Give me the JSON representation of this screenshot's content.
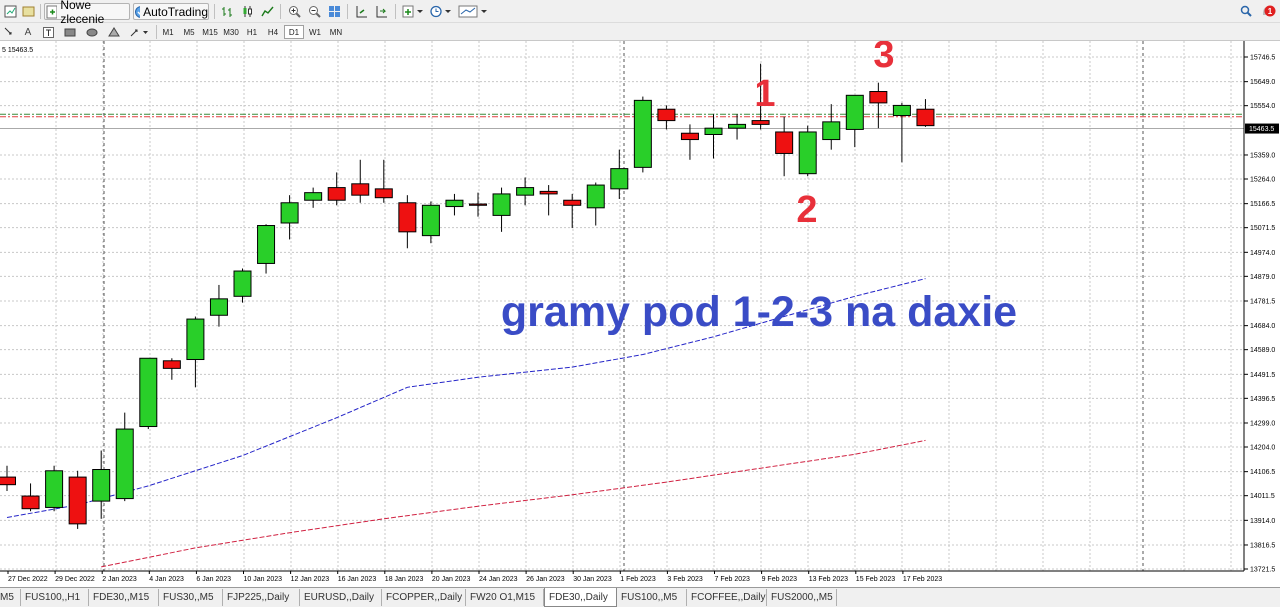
{
  "toolbar": {
    "new_order_label": "Nowe zlecenie",
    "autotrading_label": "AutoTrading",
    "notification_count": "1"
  },
  "timeframes": [
    "M1",
    "M5",
    "M15",
    "M30",
    "H1",
    "H4",
    "D1",
    "W1",
    "MN"
  ],
  "active_timeframe": "D1",
  "chart_header": "5 15463.5",
  "annotation": {
    "caption": "gramy pod 1-2-3 na daxie",
    "point1": "1",
    "point2": "2",
    "point3": "3",
    "caption_color": "#3a4cc6",
    "number_color": "#e8303a"
  },
  "tabs": [
    "M5",
    "FUS100,,H1",
    "FDE30,,M15",
    "FUS30,,M5",
    "FJP225,,Daily",
    "EURUSD,,Daily",
    "FCOPPER,,Daily",
    "FW20 O1,M15",
    "FDE30,,Daily",
    "FUS100,,M5",
    "FCOFFEE,,Daily",
    "FUS2000,,M5"
  ],
  "active_tab": "FDE30,,Daily",
  "chart_data": {
    "type": "candlestick",
    "y_ticks": [
      "15746.5",
      "15649.0",
      "15554.0",
      "15359.0",
      "15264.0",
      "15166.5",
      "15071.5",
      "14974.0",
      "14879.0",
      "14781.5",
      "14684.0",
      "14589.0",
      "14491.5",
      "14396.5",
      "14299.0",
      "14204.0",
      "14106.5",
      "14011.5",
      "13914.0",
      "13816.5",
      "13721.5"
    ],
    "current_price": "15463.5",
    "ylim": [
      13700,
      15800
    ],
    "x_labels": [
      "27 Dec 2022",
      "29 Dec 2022",
      "2 Jan 2023",
      "4 Jan 2023",
      "6 Jan 2023",
      "10 Jan 2023",
      "12 Jan 2023",
      "16 Jan 2023",
      "18 Jan 2023",
      "20 Jan 2023",
      "24 Jan 2023",
      "26 Jan 2023",
      "30 Jan 2023",
      "1 Feb 2023",
      "3 Feb 2023",
      "7 Feb 2023",
      "9 Feb 2023",
      "13 Feb 2023",
      "15 Feb 2023",
      "17 Feb 2023"
    ],
    "candles": [
      {
        "o": 14085,
        "h": 14130,
        "l": 14030,
        "c": 14055
      },
      {
        "o": 14010,
        "h": 14060,
        "l": 13950,
        "c": 13960
      },
      {
        "o": 13965,
        "h": 14130,
        "l": 13950,
        "c": 14110
      },
      {
        "o": 14085,
        "h": 14110,
        "l": 13880,
        "c": 13900
      },
      {
        "o": 13990,
        "h": 14190,
        "l": 13920,
        "c": 14115
      },
      {
        "o": 14000,
        "h": 14340,
        "l": 13990,
        "c": 14275
      },
      {
        "o": 14285,
        "h": 14555,
        "l": 14275,
        "c": 14555
      },
      {
        "o": 14545,
        "h": 14555,
        "l": 14470,
        "c": 14515
      },
      {
        "o": 14550,
        "h": 14720,
        "l": 14440,
        "c": 14710
      },
      {
        "o": 14725,
        "h": 14845,
        "l": 14680,
        "c": 14790
      },
      {
        "o": 14800,
        "h": 14910,
        "l": 14775,
        "c": 14900
      },
      {
        "o": 14930,
        "h": 15085,
        "l": 14890,
        "c": 15080
      },
      {
        "o": 15090,
        "h": 15200,
        "l": 15025,
        "c": 15170
      },
      {
        "o": 15180,
        "h": 15230,
        "l": 15150,
        "c": 15210
      },
      {
        "o": 15230,
        "h": 15290,
        "l": 15160,
        "c": 15180
      },
      {
        "o": 15245,
        "h": 15340,
        "l": 15170,
        "c": 15200
      },
      {
        "o": 15225,
        "h": 15340,
        "l": 15170,
        "c": 15190
      },
      {
        "o": 15170,
        "h": 15200,
        "l": 14990,
        "c": 15055
      },
      {
        "o": 15040,
        "h": 15175,
        "l": 15010,
        "c": 15160
      },
      {
        "o": 15155,
        "h": 15205,
        "l": 15120,
        "c": 15180
      },
      {
        "o": 15165,
        "h": 15210,
        "l": 15115,
        "c": 15160
      },
      {
        "o": 15120,
        "h": 15230,
        "l": 15055,
        "c": 15205
      },
      {
        "o": 15200,
        "h": 15270,
        "l": 15160,
        "c": 15230
      },
      {
        "o": 15215,
        "h": 15240,
        "l": 15120,
        "c": 15205
      },
      {
        "o": 15180,
        "h": 15205,
        "l": 15070,
        "c": 15160
      },
      {
        "o": 15150,
        "h": 15250,
        "l": 15080,
        "c": 15240
      },
      {
        "o": 15225,
        "h": 15380,
        "l": 15185,
        "c": 15305
      },
      {
        "o": 15310,
        "h": 15590,
        "l": 15290,
        "c": 15575
      },
      {
        "o": 15540,
        "h": 15555,
        "l": 15460,
        "c": 15495
      },
      {
        "o": 15445,
        "h": 15480,
        "l": 15340,
        "c": 15420
      },
      {
        "o": 15440,
        "h": 15520,
        "l": 15345,
        "c": 15465
      },
      {
        "o": 15465,
        "h": 15520,
        "l": 15420,
        "c": 15480
      },
      {
        "o": 15495,
        "h": 15720,
        "l": 15460,
        "c": 15480
      },
      {
        "o": 15450,
        "h": 15510,
        "l": 15275,
        "c": 15365
      },
      {
        "o": 15285,
        "h": 15475,
        "l": 15275,
        "c": 15450
      },
      {
        "o": 15420,
        "h": 15560,
        "l": 15380,
        "c": 15490
      },
      {
        "o": 15460,
        "h": 15595,
        "l": 15390,
        "c": 15595
      },
      {
        "o": 15610,
        "h": 15645,
        "l": 15465,
        "c": 15565
      },
      {
        "o": 15515,
        "h": 15565,
        "l": 15330,
        "c": 15555
      },
      {
        "o": 15540,
        "h": 15580,
        "l": 15470,
        "c": 15475
      }
    ],
    "ma_blue": [
      [
        0,
        13925
      ],
      [
        3,
        13975
      ],
      [
        6,
        14050
      ],
      [
        10,
        14170
      ],
      [
        14,
        14320
      ],
      [
        17,
        14440
      ],
      [
        20,
        14480
      ],
      [
        24,
        14520
      ],
      [
        27,
        14570
      ],
      [
        30,
        14640
      ],
      [
        33,
        14720
      ],
      [
        36,
        14800
      ],
      [
        39,
        14870
      ]
    ],
    "ma_red": [
      [
        4,
        13730
      ],
      [
        8,
        13805
      ],
      [
        12,
        13865
      ],
      [
        16,
        13920
      ],
      [
        20,
        13970
      ],
      [
        24,
        14015
      ],
      [
        28,
        14065
      ],
      [
        32,
        14120
      ],
      [
        36,
        14175
      ],
      [
        39,
        14230
      ]
    ],
    "hlines": [
      15520,
      15510
    ],
    "up_color": "#29cf29",
    "down_color": "#ee1111"
  }
}
